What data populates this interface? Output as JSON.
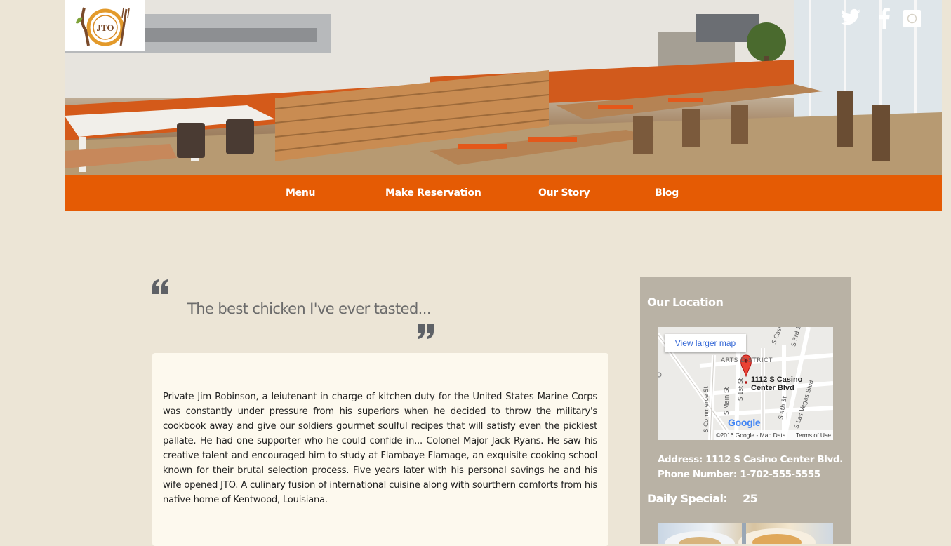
{
  "header": {
    "logo_text": "JTO",
    "hero_alt": "Restaurant interior with orange bench seating and wooden tables",
    "social": [
      {
        "icon": "twitter-icon"
      },
      {
        "icon": "facebook-icon"
      },
      {
        "icon": "instagram-icon"
      }
    ]
  },
  "nav": {
    "items": [
      "Menu",
      "Make Reservation",
      "Our Story",
      "Blog"
    ]
  },
  "testimonial": {
    "quote": "The best chicken I've ever tasted..."
  },
  "story": {
    "text": "Private Jim Robinson, a leiutenant in charge of kitchen duty for the United States Marine Corps was constantly under pressure from his superiors when he decided to throw the military's cookbook away and give our soldiers gourmet soulful recipes that will satisfy even the pickiest pallate. He had one supporter who he could confide in... Colonel Major Jack Ryans. He saw his creative talent and encouraged him to study at Flambaye Flamage, an exquisite cooking school known for their brutal selection process. Five years later with his personal savings he and his wife opened JTO. A culinary fusion of international cuisine along with sourthern comforts from his native home of Kentwood, Louisiana."
  },
  "sidebar": {
    "title": "Our Location",
    "map": {
      "button": "View larger map",
      "district": "ARTS DISTRICT",
      "place_line1": "1112 S Casino",
      "place_line2": "Center Blvd",
      "streets": [
        "S Casino",
        "S 3rd St",
        "S Commerce St",
        "S Main St",
        "S 1st St",
        "S 4th St",
        "S Las Vegas Blvd"
      ],
      "logo": "Google",
      "attribution": "©2016 Google - Map Data",
      "terms": "Terms of Use"
    },
    "address": "Address: 1112 S Casino Center Blvd.",
    "phone": "Phone Number: 1-702-555-5555",
    "special_label": "Daily Special:",
    "special_value": "25"
  },
  "colors": {
    "background": "#ece5d6",
    "nav": "#e55b04",
    "card": "#fdf9ee",
    "sidebar": "#b9b2a5"
  }
}
